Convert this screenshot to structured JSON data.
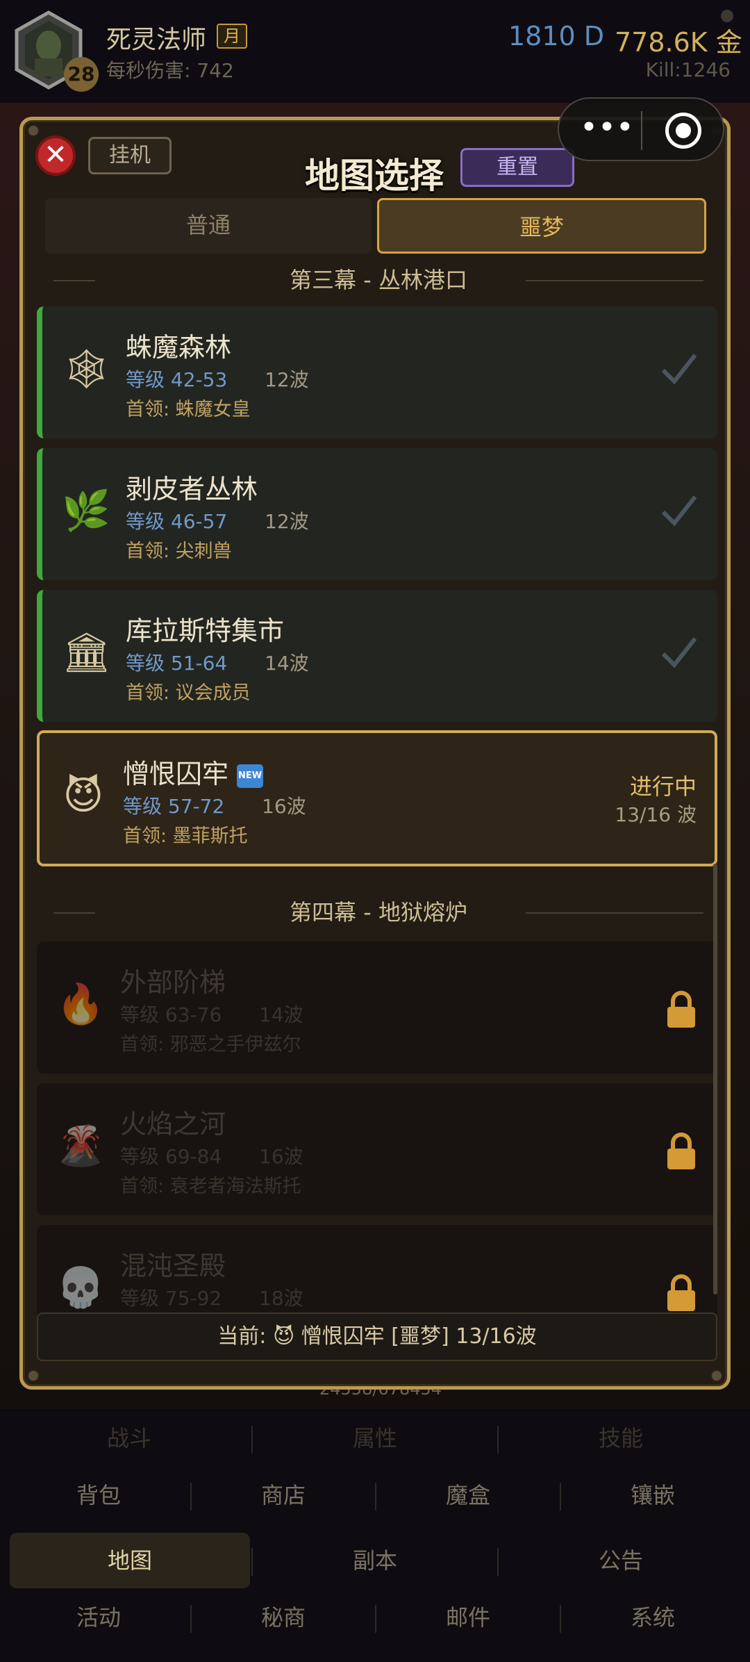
{
  "header": {
    "player_name": "死灵法师",
    "moon_tag": "月",
    "level": "28",
    "dps": "每秒伤害: 742",
    "diamonds": "1810 D",
    "gold": "778.6K 金",
    "kills": "Kill:1246"
  },
  "capsule": {
    "more": "•••"
  },
  "modal": {
    "close": "✕",
    "idle_button": "挂机",
    "title": "地图选择",
    "reset_button": "重置",
    "tabs": [
      {
        "label": "普通",
        "active": false
      },
      {
        "label": "噩梦",
        "active": true
      }
    ],
    "acts": [
      {
        "title": "第三幕 - 丛林港口",
        "maps": [
          {
            "icon": "🕸",
            "icon_name": "spider-web-icon",
            "name": "蛛魔森林",
            "level": "等级 42-53",
            "waves": "12波",
            "boss": "首领: 蛛魔女皇",
            "status": "done"
          },
          {
            "icon": "🌿",
            "icon_name": "herb-icon",
            "name": "剥皮者丛林",
            "level": "等级 46-57",
            "waves": "12波",
            "boss": "首领: 尖刺兽",
            "status": "done"
          },
          {
            "icon": "🏛",
            "icon_name": "temple-icon",
            "name": "库拉斯特集市",
            "level": "等级 51-64",
            "waves": "14波",
            "boss": "首领: 议会成员",
            "status": "done"
          },
          {
            "icon": "😈",
            "icon_name": "devil-icon",
            "name": "憎恨囚牢",
            "new_badge": "NEW",
            "level": "等级 57-72",
            "waves": "16波",
            "boss": "首领: 墨菲斯托",
            "status": "current",
            "status_text": "进行中",
            "progress": "13/16 波"
          }
        ]
      },
      {
        "title": "第四幕 - 地狱熔炉",
        "maps": [
          {
            "icon": "🔥",
            "icon_name": "fire-icon",
            "name": "外部阶梯",
            "level": "等级 63-76",
            "waves": "14波",
            "boss": "首领: 邪恶之手伊兹尔",
            "status": "locked"
          },
          {
            "icon": "🌋",
            "icon_name": "volcano-icon",
            "name": "火焰之河",
            "level": "等级 69-84",
            "waves": "16波",
            "boss": "首领: 衰老者海法斯托",
            "status": "locked"
          },
          {
            "icon": "💀",
            "icon_name": "skull-icon",
            "name": "混沌圣殿",
            "level": "等级 75-92",
            "waves": "18波",
            "boss": "",
            "status": "locked"
          }
        ]
      }
    ],
    "current_bar": "当前: 😈 憎恨囚牢 [噩梦] 13/16波"
  },
  "background": {
    "text": "24558/678454"
  },
  "bottom_nav": {
    "row1": [
      "战斗",
      "属性",
      "技能"
    ],
    "row2": [
      "背包",
      "商店",
      "魔盒",
      "镶嵌"
    ],
    "row3": [
      "地图",
      "副本",
      "公告"
    ],
    "row4": [
      "活动",
      "秘商",
      "邮件",
      "系统"
    ],
    "active": "地图"
  },
  "colors": {
    "accent_gold": "#d0ab58",
    "done_green": "#3faa3c",
    "level_blue": "#6f9acb",
    "close_red": "#c0282a",
    "reset_purple": "#8a6cc6"
  }
}
